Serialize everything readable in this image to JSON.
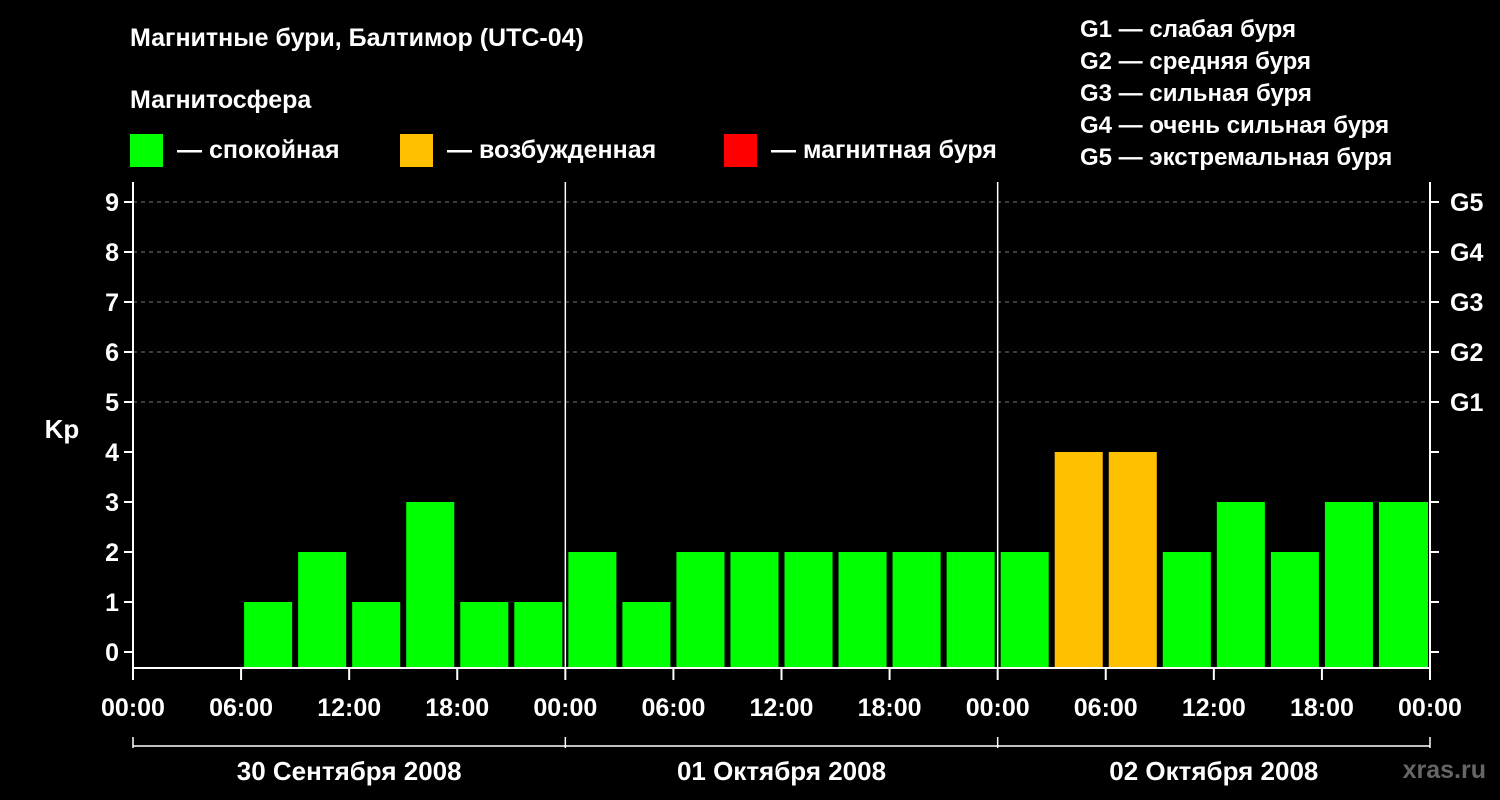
{
  "title": "Магнитные бури, Балтимор (UTC-04)",
  "subtitle": "Магнитосфера",
  "legend": [
    {
      "label": "— спокойная",
      "color": "#00ff00"
    },
    {
      "label": "— возбужденная",
      "color": "#ffc000"
    },
    {
      "label": "— магнитная буря",
      "color": "#ff0000"
    }
  ],
  "storm_levels": [
    "G1 — слабая буря",
    "G2 — средняя буря",
    "G3 — сильная буря",
    "G4 — очень сильная буря",
    "G5 — экстремальная буря"
  ],
  "watermark": "xras.ru",
  "chart_data": {
    "type": "bar",
    "ylabel": "Kp",
    "ylim": [
      0,
      9
    ],
    "yticks": [
      "0",
      "1",
      "2",
      "3",
      "4",
      "5",
      "6",
      "7",
      "8",
      "9"
    ],
    "right_ticks": [
      {
        "kp": 5,
        "label": "G1"
      },
      {
        "kp": 6,
        "label": "G2"
      },
      {
        "kp": 7,
        "label": "G3"
      },
      {
        "kp": 8,
        "label": "G4"
      },
      {
        "kp": 9,
        "label": "G5"
      }
    ],
    "grid": "dashed horizontal at Kp 5-9",
    "x_tick_labels": [
      "00:00",
      "06:00",
      "12:00",
      "18:00",
      "00:00",
      "06:00",
      "12:00",
      "18:00",
      "00:00",
      "06:00",
      "12:00",
      "18:00",
      "00:00"
    ],
    "days": [
      "30 Сентября 2008",
      "01 Октября 2008",
      "02 Октября 2008"
    ],
    "interval_hours": 3,
    "values": [
      null,
      null,
      1,
      2,
      1,
      3,
      1,
      1,
      2,
      1,
      2,
      2,
      2,
      2,
      2,
      2,
      2,
      4,
      4,
      2,
      3,
      2,
      3,
      3
    ],
    "colors": {
      "quiet": "#00ff00",
      "active": "#ffc000",
      "storm": "#ff0000"
    }
  }
}
